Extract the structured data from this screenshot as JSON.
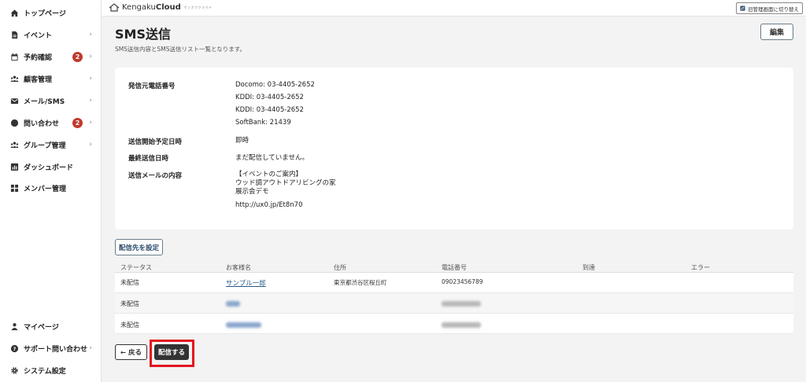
{
  "sidebar": {
    "items": [
      {
        "label": "トップページ",
        "icon": "home-icon"
      },
      {
        "label": "イベント",
        "icon": "document-icon",
        "chevron": "›"
      },
      {
        "label": "予約確認",
        "icon": "calendar-icon",
        "badge": "2",
        "chevron": "›"
      },
      {
        "label": "顧客管理",
        "icon": "users-icon",
        "chevron": "›"
      },
      {
        "label": "メール/SMS",
        "icon": "mail-icon",
        "chevron": "›"
      },
      {
        "label": "問い合わせ",
        "icon": "chat-icon",
        "badge": "2",
        "chevron": "›"
      },
      {
        "label": "グループ管理",
        "icon": "group-icon",
        "chevron": "›"
      },
      {
        "label": "ダッシュボード",
        "icon": "chart-icon"
      },
      {
        "label": "メンバー管理",
        "icon": "grid-icon"
      }
    ],
    "bottom": [
      {
        "label": "マイページ",
        "icon": "person-icon"
      },
      {
        "label": "サポート問い合わせ",
        "icon": "help-icon",
        "chevron": "›"
      },
      {
        "label": "システム設定",
        "icon": "gear-icon"
      }
    ]
  },
  "topbar": {
    "brand_prefix": "Kengaku",
    "brand_bold": "Cloud",
    "brand_sub": "ケンガククラウド",
    "switch_label": "旧管理画面に切り替え"
  },
  "header": {
    "title": "SMS送信",
    "description": "SMS送信内容とSMS送信リスト一覧となります。",
    "edit_label": "編集"
  },
  "details": {
    "sender_label": "発信元電話番号",
    "sender_values": [
      "Docomo: 03-4405-2652",
      "KDDI: 03-4405-2652",
      "KDDI: 03-4405-2652",
      "SoftBank: 21439"
    ],
    "schedule_label": "送信開始予定日時",
    "schedule_value": "即時",
    "last_sent_label": "最終送信日時",
    "last_sent_value": "まだ配信していません。",
    "content_label": "送信メールの内容",
    "content_lines": [
      "【イベントのご案内】",
      "ウッド調アウトドアリビングの家",
      "展示会デモ"
    ],
    "content_url": "http://ux0.jp/Et8n70"
  },
  "recipients": {
    "set_label": "配信先を設定",
    "columns": [
      "ステータス",
      "お客様名",
      "住所",
      "電話番号",
      "到達",
      "エラー"
    ],
    "rows": [
      {
        "status": "未配信",
        "name": "サンプル一郎",
        "address": "東京都渋谷区桜丘町",
        "phone": "09023456789"
      },
      {
        "status": "未配信"
      },
      {
        "status": "未配信"
      }
    ]
  },
  "footer": {
    "back_label": "← 戻る",
    "send_label": "配信する"
  },
  "colors": {
    "badge": "#c0392b",
    "highlight": "#e2161d",
    "primary_dark": "#333333",
    "link": "#2a5a8a"
  }
}
